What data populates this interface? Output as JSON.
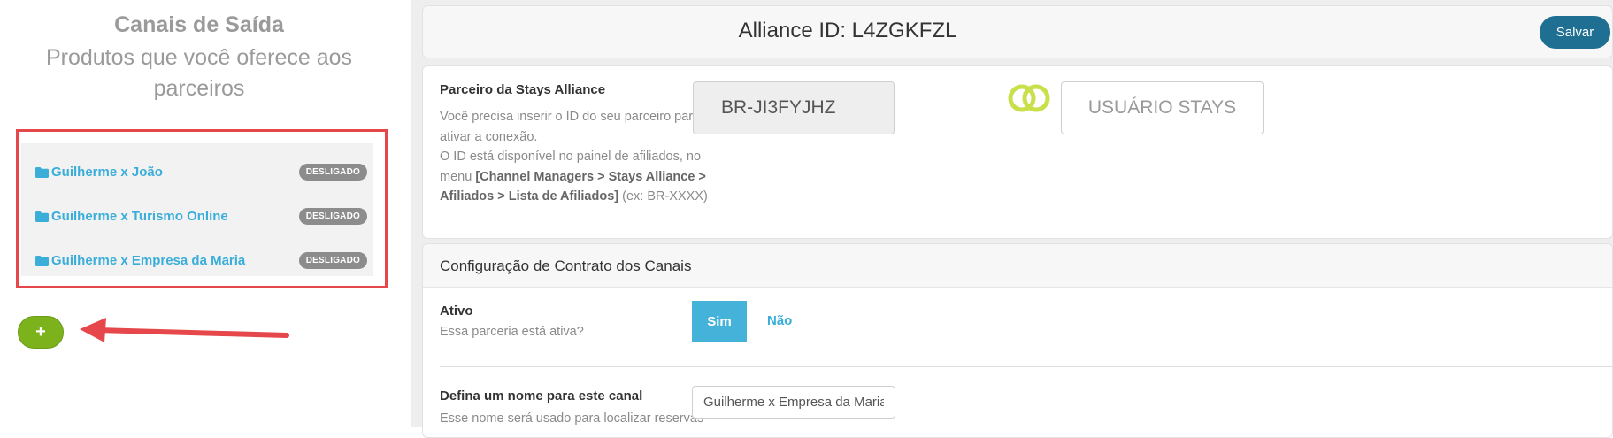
{
  "sidebar": {
    "title": "Canais de Saída",
    "subtitle": "Produtos que você oferece aos parceiros",
    "channels": [
      {
        "name": "Guilherme x João",
        "status": "DESLIGADO"
      },
      {
        "name": "Guilherme x Turismo Online",
        "status": "DESLIGADO"
      },
      {
        "name": "Guilherme x Empresa da Maria",
        "status": "DESLIGADO"
      }
    ],
    "add_label": "+"
  },
  "header": {
    "alliance_id": "Alliance ID: L4ZGKFZL",
    "save_label": "Salvar"
  },
  "partner": {
    "title": "Parceiro da Stays Alliance",
    "desc_1": "Você precisa inserir o ID do seu parceiro para ativar a conexão.",
    "desc_2": "O ID está disponível no painel de afiliados, no menu ",
    "desc_menu": "[Channel Managers > Stays Alliance > Afiliados > Lista de Afiliados]",
    "desc_example": " (ex: BR-XXXX)",
    "partner_id": "BR-JI3FYJHZ",
    "user_label": "USUÁRIO STAYS"
  },
  "contract": {
    "title": "Configuração de Contrato dos Canais",
    "active_label": "Ativo",
    "active_help": "Essa parceria está ativa?",
    "yes_label": "Sim",
    "no_label": "Não",
    "name_label": "Defina um nome para este canal",
    "name_help": "Esse nome será usado para localizar reservas",
    "name_value": "Guilherme x Empresa da Maria"
  },
  "colors": {
    "link": "#3aaed8",
    "save": "#1f6f93",
    "add": "#7cb31d",
    "highlight": "#e5474b",
    "rings": "#c9e04a"
  }
}
